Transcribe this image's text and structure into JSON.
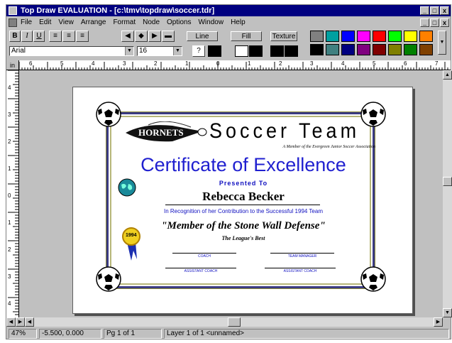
{
  "window": {
    "title": "Top Draw EVALUATION - [c:\\tmv\\topdraw\\soccer.tdr]",
    "controls": [
      "_",
      "□",
      "x"
    ],
    "doc_controls": [
      "_",
      "□",
      "x"
    ]
  },
  "menu": [
    "File",
    "Edit",
    "View",
    "Arrange",
    "Format",
    "Node",
    "Options",
    "Window",
    "Help"
  ],
  "toolbar": {
    "style_buttons": [
      "B",
      "I",
      "U"
    ],
    "align_buttons": [
      "≡",
      "≡",
      "≡"
    ],
    "line_label": "Line",
    "fill_label": "Fill",
    "texture_label": "Texture",
    "font_value": "Arial",
    "size_value": "16",
    "palette": [
      "#808080",
      "#00a0a0",
      "#0000ff",
      "#ff00ff",
      "#ff0000",
      "#00ff00",
      "#ffff00",
      "#ff8000",
      "#000000",
      "#408080",
      "#000080",
      "#800080",
      "#800000",
      "#808000",
      "#008000",
      "#804000"
    ]
  },
  "ruler": {
    "unit": "in",
    "h_labels": [
      "6",
      "5",
      "4",
      "3",
      "2",
      "1",
      "0",
      "1",
      "2",
      "3",
      "4",
      "5",
      "6",
      "7"
    ],
    "v_labels": [
      "4",
      "3",
      "2",
      "1",
      "0",
      "1",
      "2",
      "3",
      "4"
    ]
  },
  "certificate": {
    "team_logo": "HORNETS",
    "team_name": "Soccer Team",
    "tagline": "A Member of the Evergreen Junior Soccer Association",
    "heading": "Certificate of Excellence",
    "presented": "Presented To",
    "recipient": "Rebecca Becker",
    "recognition": "In Recognition of her Contribution to the Successful 1994 Team",
    "quote": "\"Member of the Stone Wall Defense\"",
    "subquote": "The League's Best",
    "ribbon_year": "1994",
    "sig_labels": [
      "COACH",
      "TEAM MANAGER",
      "ASSISTANT COACH",
      "ASSISTANT COACH"
    ]
  },
  "status": {
    "zoom": "47%",
    "coords": "-5.500, 0.000",
    "page": "Pg 1 of 1",
    "layer": "Layer 1 of 1  <unnamed>"
  }
}
